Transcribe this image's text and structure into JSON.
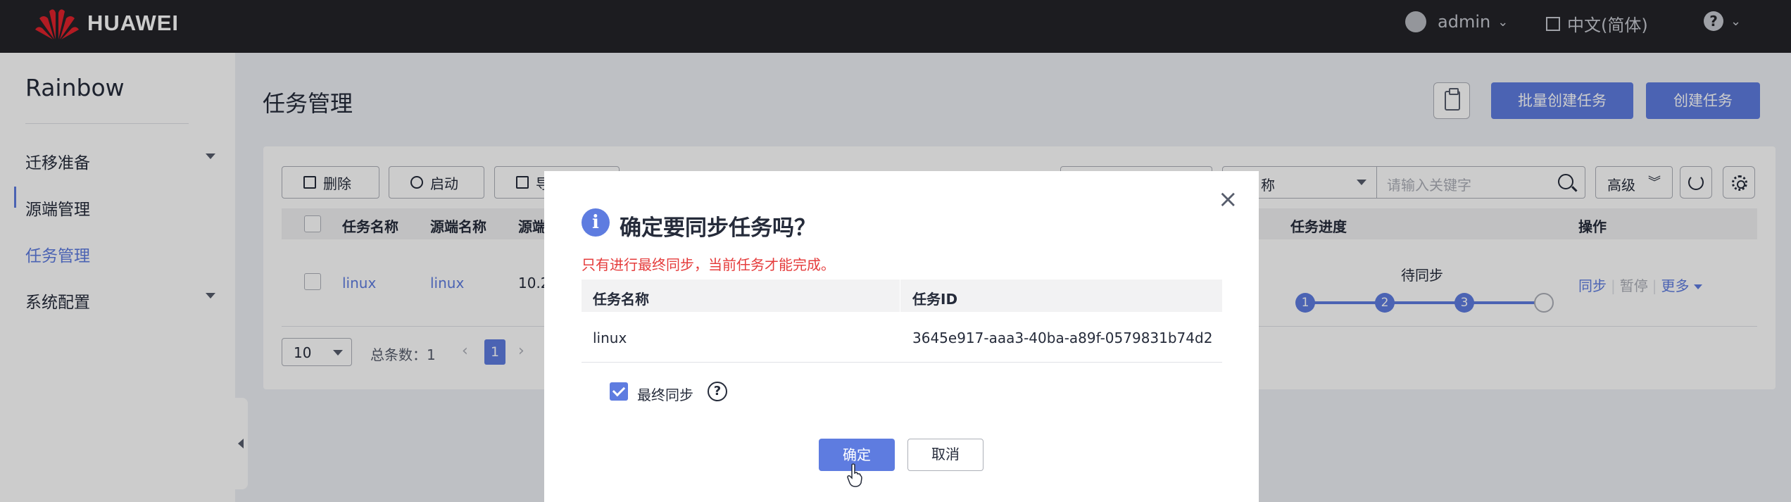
{
  "topbar": {
    "brand": "HUAWEI",
    "user": "admin",
    "language": "中文(简体)",
    "help_icon": "question-circle-icon"
  },
  "sidebar": {
    "title": "Rainbow",
    "items": [
      {
        "label": "迁移准备",
        "expandable": true
      },
      {
        "label": "源端管理",
        "expandable": false
      },
      {
        "label": "任务管理",
        "expandable": false,
        "active": true
      },
      {
        "label": "系统配置",
        "expandable": true
      }
    ]
  },
  "header": {
    "title": "任务管理",
    "batch_create": "批量创建任务",
    "create": "创建任务"
  },
  "toolbar": {
    "delete": "删除",
    "start": "启动",
    "export": "导"
  },
  "filter": {
    "field": "务名称",
    "placeholder": "请输入关键字",
    "advanced": "高级"
  },
  "table": {
    "headers": [
      "任务名称",
      "源端名称",
      "源端",
      "任务进度",
      "操作"
    ],
    "rows": [
      {
        "task_name": "linux",
        "source_name": "linux",
        "source_ip": "10.2",
        "progress_label": "待同步",
        "progress_steps": [
          "1",
          "2",
          "3"
        ],
        "ops": {
          "sync": "同步",
          "pause": "暂停",
          "more": "更多"
        }
      }
    ]
  },
  "pagination": {
    "page_size": "10",
    "total": "总条数：1",
    "current_page": "1"
  },
  "dialog": {
    "title": "确定要同步任务吗？",
    "warning": "只有进行最终同步，当前任务才能完成。",
    "headers": [
      "任务名称",
      "任务ID"
    ],
    "row": {
      "name": "linux",
      "id": "3645e917-aaa3-40ba-a89f-0579831b74d2"
    },
    "checkbox_label": "最终同步",
    "checkbox_checked": true,
    "ok": "确定",
    "cancel": "取消"
  },
  "colors": {
    "primary": "#5e7ce0",
    "topbar": "#232429",
    "warning": "#e53c3c"
  }
}
